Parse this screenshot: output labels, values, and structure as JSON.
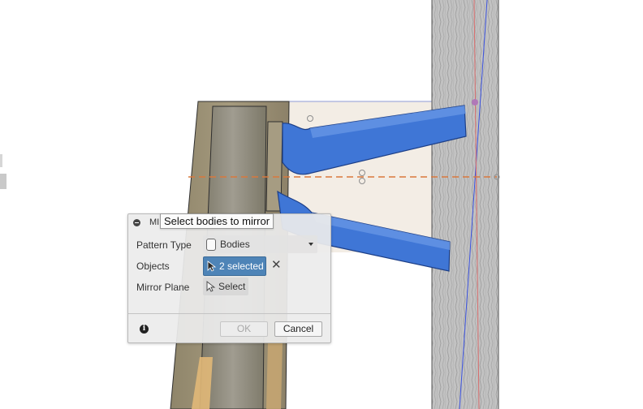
{
  "tooltip": {
    "text": "Select bodies to mirror"
  },
  "dialog": {
    "title_fragment": "MI",
    "pattern_type": {
      "label": "Pattern Type",
      "value": "Bodies"
    },
    "objects": {
      "label": "Objects",
      "value": "2 selected"
    },
    "mirror_plane": {
      "label": "Mirror Plane",
      "value": "Select"
    },
    "ok_label": "OK",
    "cancel_label": "Cancel"
  },
  "colors": {
    "selected_body": "#3f76d6",
    "selection_button": "#4e84b7",
    "mirror_plane_line": "#d9783c",
    "wood_surface": "#b9b9b9"
  },
  "icons": [
    "collapse-icon",
    "body-icon",
    "cursor-icon",
    "clear-icon",
    "info-icon",
    "dropdown-caret-icon"
  ]
}
